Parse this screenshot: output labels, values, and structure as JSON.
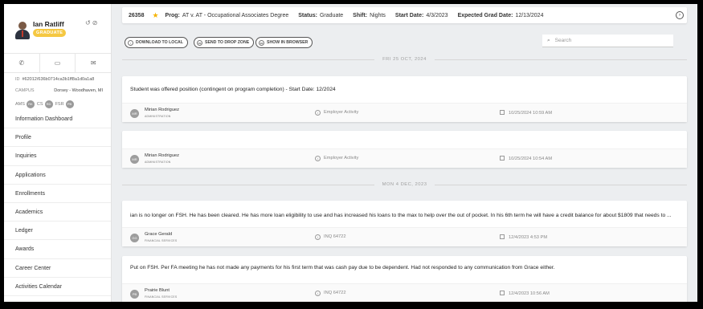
{
  "student": {
    "name": "Ian Ratliff",
    "badge": "GRADUATE",
    "id_label": "ID",
    "id_value": "#62012/636b0714ca3b1ff8a1d0a1a8",
    "campus_label": "CAMPUS",
    "campus_value": "Dorsey - Woodhaven, MI",
    "team": [
      {
        "role": "AMS",
        "initials": "RK"
      },
      {
        "role": "CS",
        "initials": "RD"
      },
      {
        "role": "FSR",
        "initials": "PB"
      }
    ]
  },
  "icons": {
    "history": "history-icon",
    "eye_off": "eye-off-icon",
    "phone": "phone-icon",
    "chat": "chat-icon",
    "email": "email-icon",
    "star": "star-icon",
    "collapse": "chevron-right-circle-icon",
    "search": "search-icon",
    "download": "download-icon",
    "print": "print-icon"
  },
  "nav": [
    "Information Dashboard",
    "Profile",
    "Inquiries",
    "Applications",
    "Enrollments",
    "Academics",
    "Ledger",
    "Awards",
    "Career Center",
    "Activities Calendar"
  ],
  "header": {
    "id": "26358",
    "prog_label": "Prog:",
    "prog": "AT v. AT - Occupational Associates Degree",
    "status_label": "Status:",
    "status": "Graduate",
    "shift_label": "Shift:",
    "shift": "Nights",
    "start_label": "Start Date:",
    "start": "4/3/2023",
    "grad_label": "Expected Grad Date:",
    "grad": "12/13/2024"
  },
  "toolbar": {
    "download": "DOWNLOAD TO LOCAL",
    "drop_zone": "SEND TO DROP ZONE",
    "browser": "SHOW IN BROWSER",
    "search_placeholder": "Search"
  },
  "dates": {
    "d1": "FRI 25 OCT, 2024",
    "d2": "MON 4 DEC, 2023"
  },
  "notes": [
    {
      "text": "Student was offered position (contingent on program completion) - Start Date: 12/2024",
      "initials": "MR",
      "author": "Mirian Rodriguez",
      "role": "ADMINISTRATION",
      "activity": "Employer Activity",
      "timestamp": "10/25/2024 10:59 AM"
    },
    {
      "text": "",
      "initials": "MR",
      "author": "Mirian Rodriguez",
      "role": "ADMINISTRATION",
      "activity": "Employer Activity",
      "timestamp": "10/25/2024 10:54 AM"
    },
    {
      "text": "ian is no longer on FSH. He has been cleared. He has more loan eligibility to use and has increased his loans to the max to help over the out of pocket. In his 6th term he will have a credit balance for about $1809 that needs to ...",
      "initials": "GG",
      "author": "Grace Gerald",
      "role": "FINANCIAL SERVICES",
      "activity": "INQ 64722",
      "timestamp": "12/4/2023 4:53 PM"
    },
    {
      "text": "Put on FSH. Per FA meeting he has not made any payments for his first term that was cash pay due to be dependent. Had not responded to any communication from Grace either.",
      "initials": "PB",
      "author": "Prairie Blunt",
      "role": "FINANCIAL SERVICES",
      "activity": "INQ 64722",
      "timestamp": "12/4/2023 10:56 AM"
    }
  ]
}
